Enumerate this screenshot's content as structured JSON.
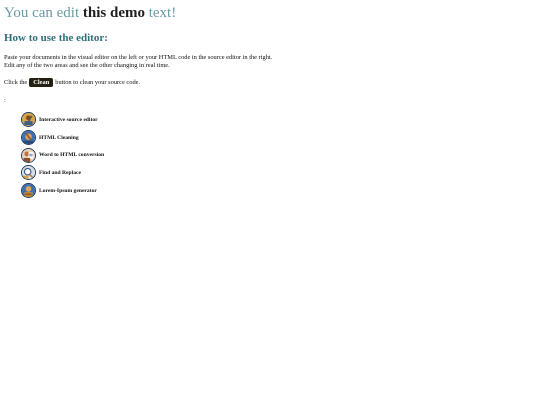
{
  "headline": {
    "part1": "You can edit",
    "part2": "this demo",
    "part3": "text!"
  },
  "howto": {
    "title": "How to use the editor:",
    "line1": "Paste your documents in the visual editor on the left or your HTML code in the source editor in the right.",
    "line2": "Edit any of the two areas and see the other changing in real time.",
    "click_prefix": "Click the",
    "clean_label": "Clean",
    "click_suffix": "button to clean your source code."
  },
  "colon": ":",
  "features": [
    {
      "label": "Interactive source editor",
      "icon": "tools-avatar-icon"
    },
    {
      "label": "HTML Cleaning",
      "icon": "broom-avatar-icon"
    },
    {
      "label": "Word to HTML conversion",
      "icon": "document-avatar-icon"
    },
    {
      "label": "Find and Replace",
      "icon": "magnifier-avatar-icon"
    },
    {
      "label": "Lorem-Ipsum generator",
      "icon": "text-avatar-icon"
    }
  ],
  "colors": {
    "teal_text": "#6a9aa3",
    "heading_teal": "#2f6f7a",
    "clean_button_bg": "#241f12"
  }
}
